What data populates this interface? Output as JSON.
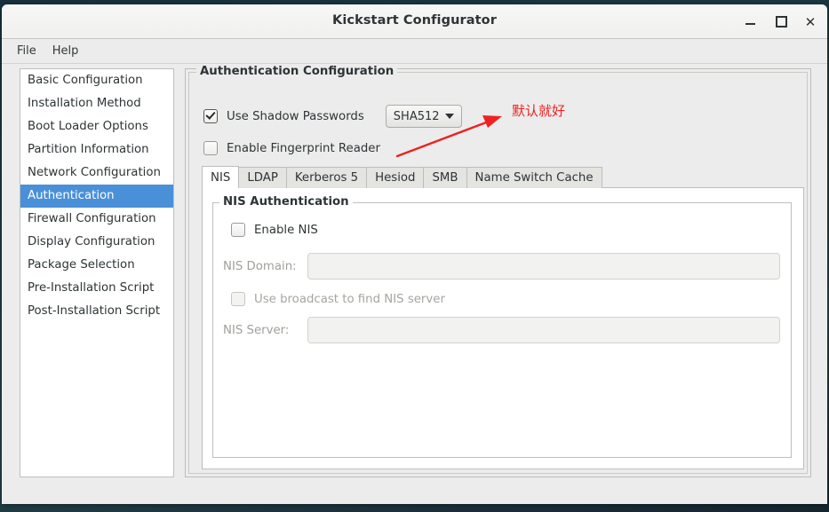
{
  "window": {
    "title": "Kickstart Configurator",
    "controls": {
      "minimize": "minimize",
      "maximize": "maximize",
      "close": "close"
    }
  },
  "menubar": {
    "items": [
      {
        "label": "File"
      },
      {
        "label": "Help"
      }
    ]
  },
  "sidebar": {
    "items": [
      {
        "label": "Basic Configuration",
        "selected": false
      },
      {
        "label": "Installation Method",
        "selected": false
      },
      {
        "label": "Boot Loader Options",
        "selected": false
      },
      {
        "label": "Partition Information",
        "selected": false
      },
      {
        "label": "Network Configuration",
        "selected": false
      },
      {
        "label": "Authentication",
        "selected": true
      },
      {
        "label": "Firewall Configuration",
        "selected": false
      },
      {
        "label": "Display Configuration",
        "selected": false
      },
      {
        "label": "Package Selection",
        "selected": false
      },
      {
        "label": "Pre-Installation Script",
        "selected": false
      },
      {
        "label": "Post-Installation Script",
        "selected": false
      }
    ],
    "selected_color": "#4a90d9"
  },
  "main": {
    "group_title": "Authentication Configuration",
    "shadow_passwords": {
      "label": "Use Shadow Passwords",
      "checked": true
    },
    "hash_combo": {
      "value": "SHA512",
      "icon": "chevron-down-icon"
    },
    "fingerprint": {
      "label": "Enable Fingerprint Reader",
      "checked": false
    },
    "annotation": {
      "text": "默认就好",
      "color": "#ee2222"
    },
    "tabs": [
      {
        "label": "NIS",
        "active": true
      },
      {
        "label": "LDAP",
        "active": false
      },
      {
        "label": "Kerberos 5",
        "active": false
      },
      {
        "label": "Hesiod",
        "active": false
      },
      {
        "label": "SMB",
        "active": false
      },
      {
        "label": "Name Switch Cache",
        "active": false
      }
    ],
    "nis_panel": {
      "group_title": "NIS Authentication",
      "enable": {
        "label": "Enable NIS",
        "checked": false
      },
      "domain": {
        "label": "NIS Domain:",
        "value": "",
        "disabled": true
      },
      "broadcast": {
        "label": "Use broadcast to find NIS server",
        "checked": false,
        "disabled": true
      },
      "server": {
        "label": "NIS Server:",
        "value": "",
        "disabled": true
      }
    }
  }
}
